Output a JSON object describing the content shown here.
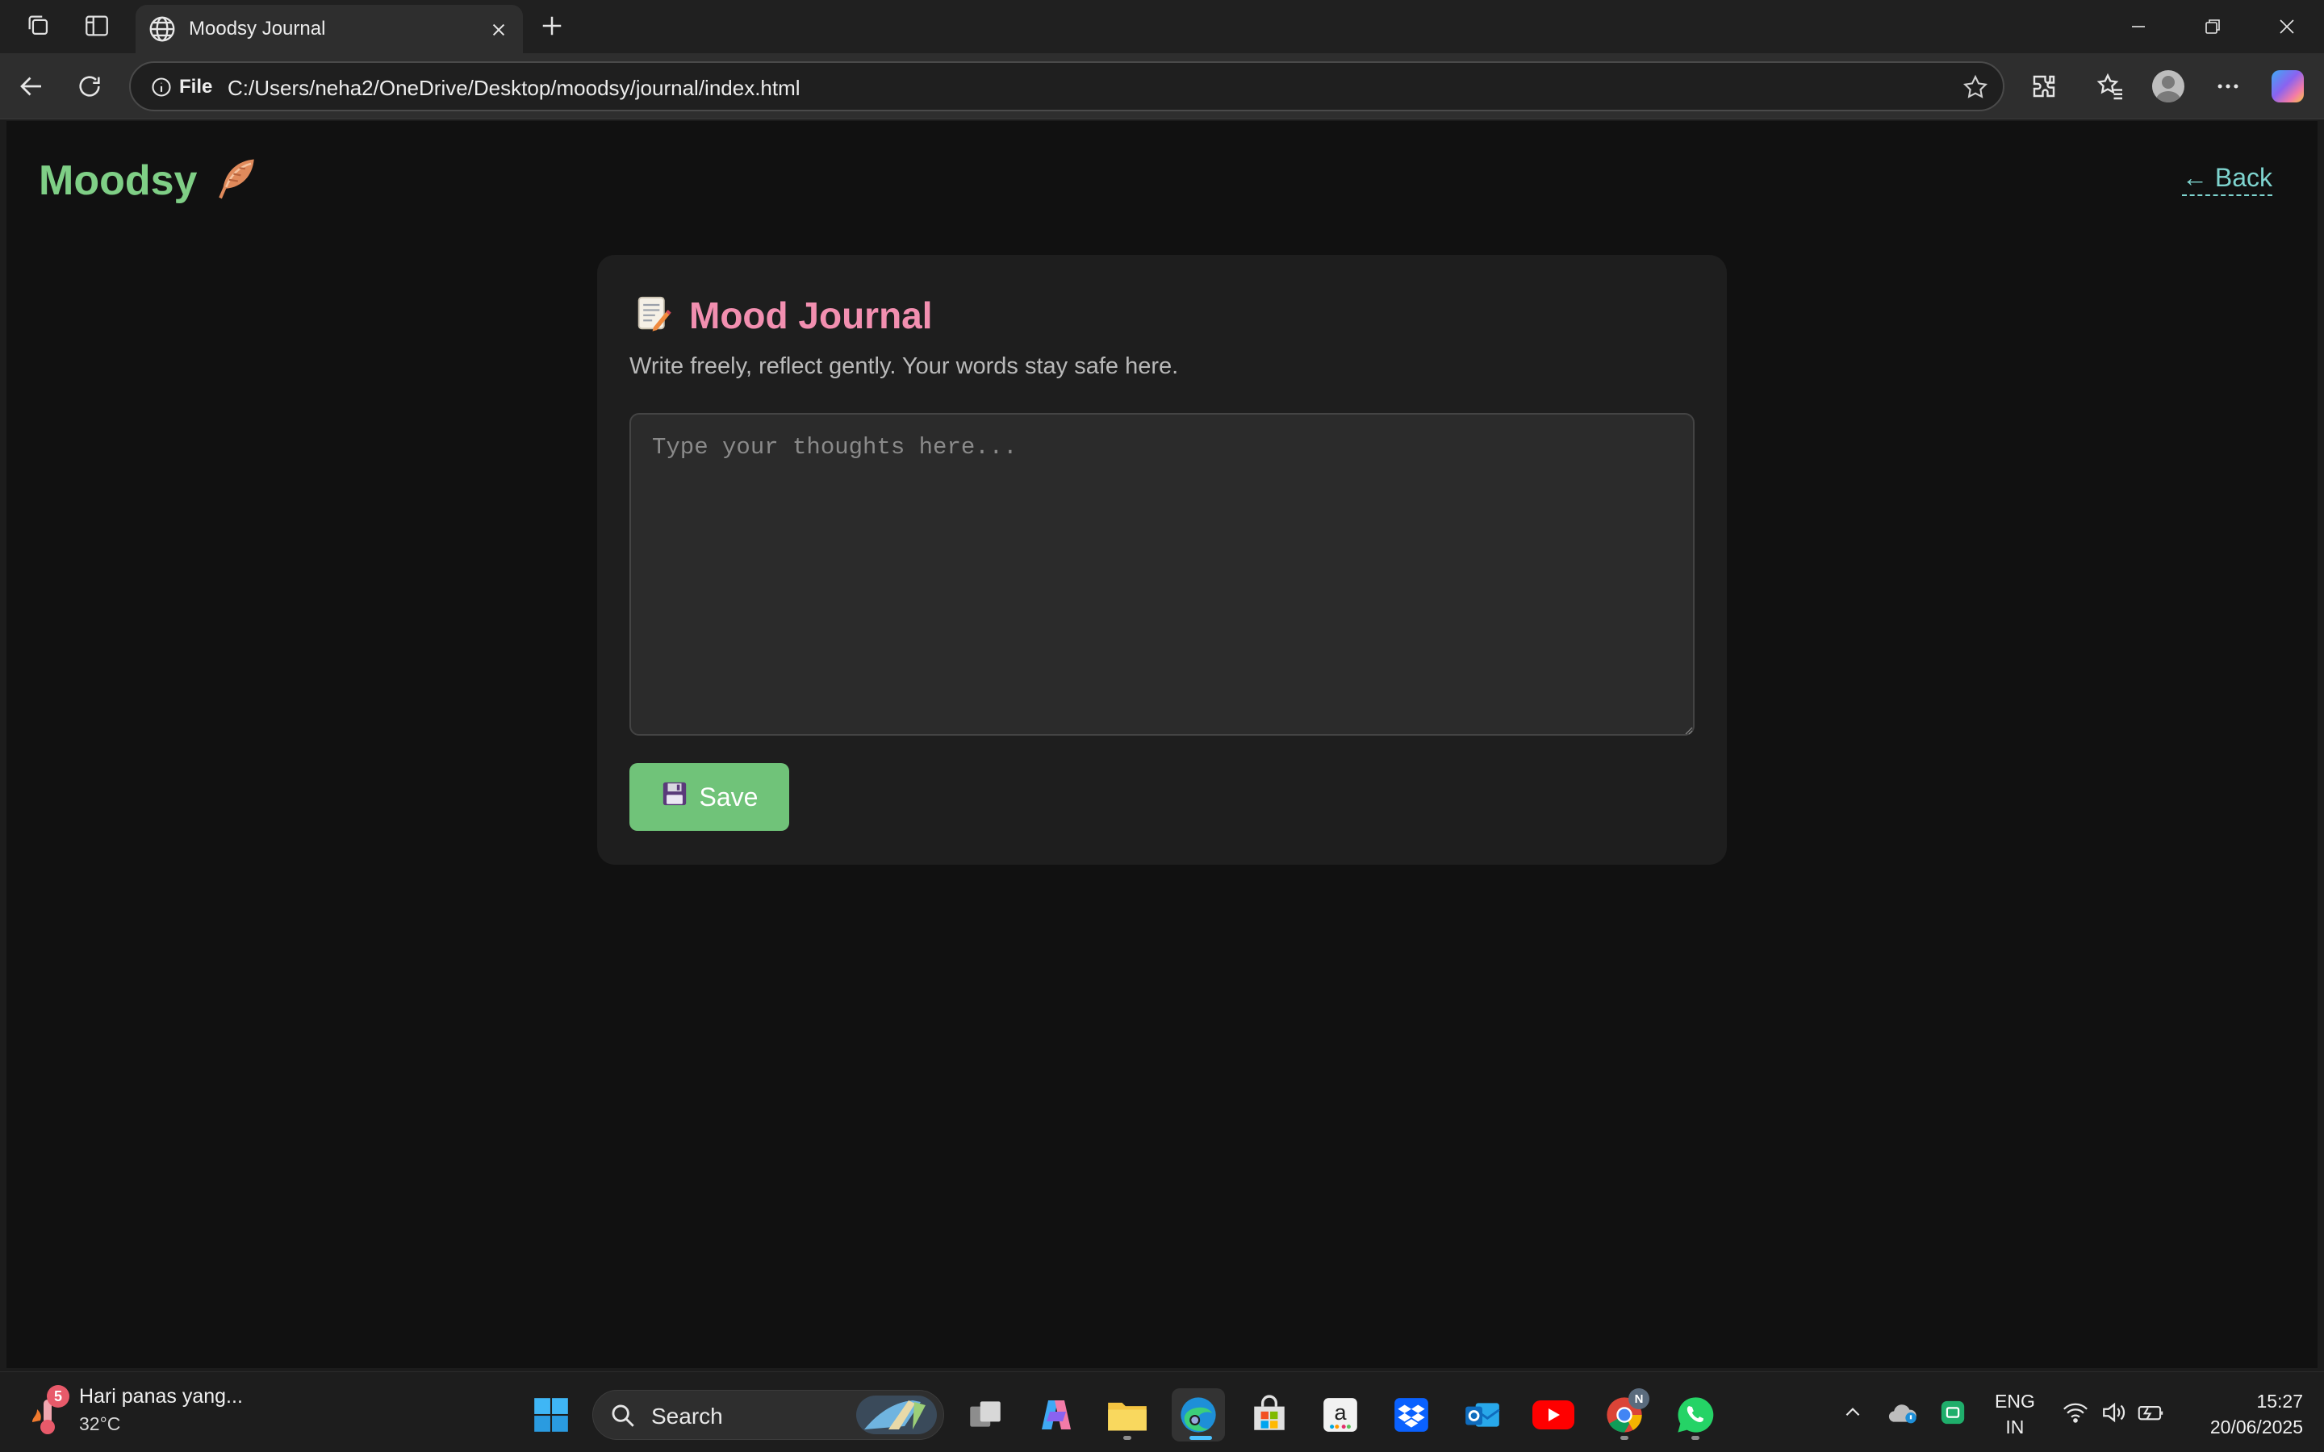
{
  "browser": {
    "tab_title": "Moodsy Journal",
    "address_scheme": "File",
    "address_url": "C:/Users/neha2/OneDrive/Desktop/moodsy/journal/index.html"
  },
  "page": {
    "brand": "Moodsy",
    "brand_icon": "feather-icon",
    "back_link": "← Back",
    "card": {
      "title_icon": "memo-icon",
      "title": "Mood Journal",
      "subtitle": "Write freely, reflect gently. Your words stay safe here.",
      "textarea_placeholder": "Type your thoughts here...",
      "textarea_value": "",
      "save_label": "Save",
      "save_icon": "floppy-disk-icon"
    }
  },
  "taskbar": {
    "weather_badge": "5",
    "weather_title": "Hari panas yang...",
    "weather_temp": "32°C",
    "search_label": "Search",
    "lang_line1": "ENG",
    "lang_line2": "IN",
    "time": "15:27",
    "date": "20/06/2025"
  },
  "colors": {
    "brand": "#7fcf86",
    "title": "#f28fb0",
    "link": "#7ed4cf",
    "save": "#70c379",
    "page_bg": "#111111",
    "card_bg": "#1e1e1e"
  }
}
